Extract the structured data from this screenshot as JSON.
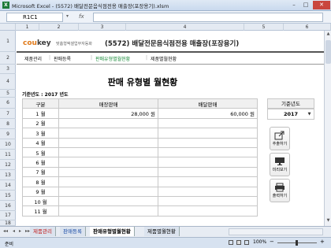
{
  "window": {
    "app_icon": "excel-icon",
    "title": "Microsoft Excel - (5572) 배달전문음식점전용 매출장(포장용기).xlsm",
    "buttons": [
      "minimize-icon",
      "maximize-icon",
      "close-icon"
    ]
  },
  "formula_bar": {
    "name_box": "R1C1",
    "fx_label": "fx",
    "content": ""
  },
  "columns": [
    "1",
    "2",
    "3",
    "4",
    "5",
    "6"
  ],
  "rows": [
    "1",
    "2",
    "3",
    "4",
    "5",
    "6",
    "7",
    "8",
    "9",
    "10",
    "11",
    "12",
    "13",
    "14",
    "15",
    "16",
    "17",
    "18",
    "19",
    "20"
  ],
  "header": {
    "logo_main": "coukey",
    "logo_sub": "맞춤형엑셀업무자동화",
    "doc_title": "(5572) 배달전문음식점전용 매출장(포장용기)"
  },
  "nav": [
    {
      "label": "제품관리",
      "active": false
    },
    {
      "label": "판매등록",
      "active": false
    },
    {
      "label": "판매유형별월현황",
      "active": true
    },
    {
      "label": "제품별월현황",
      "active": false
    }
  ],
  "report": {
    "title": "판매 유형별 월현황",
    "basis_label": "기준년도 : 2017 년도",
    "headers": [
      "구분",
      "매장판매",
      "배달판매"
    ],
    "rows": [
      {
        "month": "1 월",
        "store": "28,000 원",
        "delivery": "60,000 원"
      },
      {
        "month": "2 월",
        "store": "",
        "delivery": ""
      },
      {
        "month": "3 월",
        "store": "",
        "delivery": ""
      },
      {
        "month": "4 월",
        "store": "",
        "delivery": ""
      },
      {
        "month": "5 월",
        "store": "",
        "delivery": ""
      },
      {
        "month": "6 월",
        "store": "",
        "delivery": ""
      },
      {
        "month": "7 월",
        "store": "",
        "delivery": ""
      },
      {
        "month": "8 월",
        "store": "",
        "delivery": ""
      },
      {
        "month": "9 월",
        "store": "",
        "delivery": ""
      },
      {
        "month": "10 월",
        "store": "",
        "delivery": ""
      },
      {
        "month": "11 월",
        "store": "",
        "delivery": ""
      }
    ]
  },
  "side": {
    "year_label": "기준년도",
    "year_value": "2017",
    "buttons": [
      {
        "label": "추출하기",
        "icon": "export-icon"
      },
      {
        "label": "미리보기",
        "icon": "monitor-icon"
      },
      {
        "label": "출력하기",
        "icon": "print-icon"
      }
    ]
  },
  "tabs": [
    "제품관리",
    "판매등록",
    "판매유형별월현황",
    "제품별월현황"
  ],
  "status": {
    "ready": "준비",
    "zoom": "100%"
  }
}
